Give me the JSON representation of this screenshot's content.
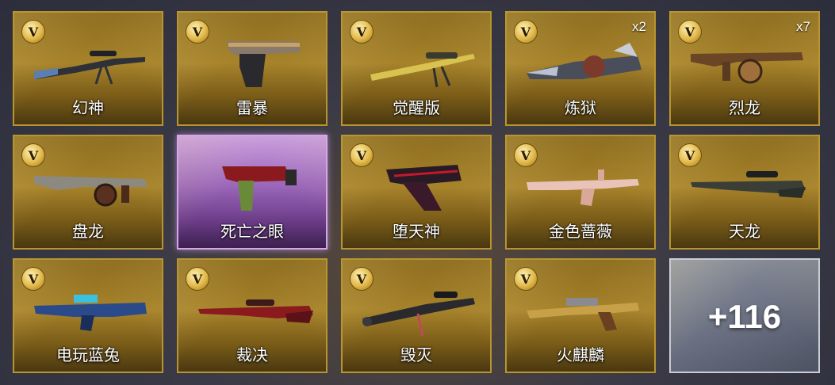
{
  "items": [
    {
      "name": "幻神",
      "badge": "V",
      "multiplier": "",
      "weapon_type": "sniper"
    },
    {
      "name": "雷暴",
      "badge": "V",
      "multiplier": "",
      "weapon_type": "pistol"
    },
    {
      "name": "觉醒版",
      "badge": "V",
      "multiplier": "",
      "weapon_type": "heavy-sniper"
    },
    {
      "name": "炼狱",
      "badge": "V",
      "multiplier": "x2",
      "weapon_type": "gatling"
    },
    {
      "name": "烈龙",
      "badge": "V",
      "multiplier": "x7",
      "weapon_type": "tommy-gun"
    },
    {
      "name": "盘龙",
      "badge": "V",
      "multiplier": "",
      "weapon_type": "tommy-gun"
    },
    {
      "name": "死亡之眼",
      "badge": "",
      "multiplier": "",
      "weapon_type": "smg"
    },
    {
      "name": "堕天神",
      "badge": "V",
      "multiplier": "",
      "weapon_type": "pistol"
    },
    {
      "name": "金色蔷薇",
      "badge": "V",
      "multiplier": "",
      "weapon_type": "rifle"
    },
    {
      "name": "天龙",
      "badge": "V",
      "multiplier": "",
      "weapon_type": "sniper"
    },
    {
      "name": "电玩蓝兔",
      "badge": "V",
      "multiplier": "",
      "weapon_type": "rifle"
    },
    {
      "name": "裁决",
      "badge": "V",
      "multiplier": "",
      "weapon_type": "sniper"
    },
    {
      "name": "毁灭",
      "badge": "V",
      "multiplier": "",
      "weapon_type": "heavy-sniper"
    },
    {
      "name": "火麒麟",
      "badge": "V",
      "multiplier": "",
      "weapon_type": "rifle"
    }
  ],
  "more": {
    "label": "+116"
  },
  "colors": {
    "gold_card": "#a7832b",
    "purple_card": "#9a66b8",
    "silver_card": "#6d7384"
  }
}
